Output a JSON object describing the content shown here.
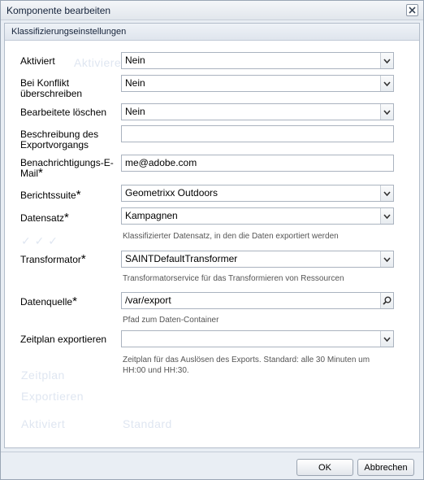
{
  "window": {
    "title": "Komponente bearbeiten"
  },
  "panel": {
    "title": "Klassifizierungseinstellungen"
  },
  "fields": {
    "aktiviert": {
      "label": "Aktiviert",
      "value": "Nein"
    },
    "konflikt": {
      "label_line1": "Bei Konflikt",
      "label_line2": "überschreiben",
      "value": "Nein"
    },
    "loeschen": {
      "label": "Bearbeitete löschen",
      "value": "Nein"
    },
    "beschreibung": {
      "label_line1": "Beschreibung des",
      "label_line2": "Exportvorgangs",
      "value": ""
    },
    "email": {
      "label_line1": "Benachrichtigungs-E-",
      "label_line2": "Mail",
      "value": "me@adobe.com"
    },
    "berichtssuite": {
      "label": "Berichtssuite",
      "value": "Geometrixx Outdoors"
    },
    "datensatz": {
      "label": "Datensatz",
      "value": "Kampagnen",
      "help": "Klassifizierter Datensatz, in den die Daten exportiert werden"
    },
    "transformator": {
      "label": "Transformator",
      "value": "SAINTDefaultTransformer",
      "help": "Transformatorservice für das Transformieren von Ressourcen"
    },
    "datenquelle": {
      "label": "Datenquelle",
      "value": "/var/export",
      "help": "Pfad zum Daten-Container"
    },
    "zeitplan": {
      "label": "Zeitplan exportieren",
      "value": "",
      "help_line1": "Zeitplan für das Auslösen des Exports. Standard: alle 30 Minuten um",
      "help_line2": "HH:00 und HH:30."
    }
  },
  "required_marker": "*",
  "buttons": {
    "ok": "OK",
    "cancel": "Abbrechen"
  },
  "icons": {
    "close": "close-icon",
    "dropdown": "chevron-down-icon",
    "browse": "search-icon"
  }
}
